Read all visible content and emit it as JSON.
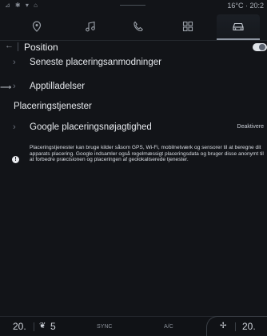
{
  "status_bar": {
    "left_icons": "⊿ ✱ ▾ ⌂",
    "temp_time": "16°C · 20:2"
  },
  "nav": {
    "items": [
      {
        "name": "navigation",
        "icon": "location-pin-icon"
      },
      {
        "name": "media",
        "icon": "music-note-icon"
      },
      {
        "name": "phone",
        "icon": "phone-icon"
      },
      {
        "name": "apps",
        "icon": "grid-icon"
      },
      {
        "name": "vehicle",
        "icon": "car-icon",
        "active": true
      }
    ]
  },
  "header": {
    "back_glyph": "←",
    "title": "Position"
  },
  "rows": {
    "recent_requests": "Seneste placeringsanmodninger",
    "permissions": "Apptilladelser",
    "section_title": "Placeringstjenester",
    "google_accuracy": "Google placeringsnøjagtighed",
    "google_accuracy_status": "Deaktivere"
  },
  "info": {
    "text": "Placeringstjenester kan bruge kilder såsom GPS, Wi-Fi, mobilnetværk og sensorer til at beregne dit apparats placering. Google indsamler også regelmæssigt placeringsdata og bruger disse anonymt til at forbedre præcisionen og placeringen af geolokaliserede tjenester."
  },
  "climate": {
    "left_temp": "20.",
    "fan_level": "5",
    "sync_label": "SYNC",
    "ac_label": "A/C",
    "right_temp": "20."
  },
  "colors": {
    "background": "#121418",
    "text": "#e8eaee",
    "muted": "#8a9099"
  }
}
